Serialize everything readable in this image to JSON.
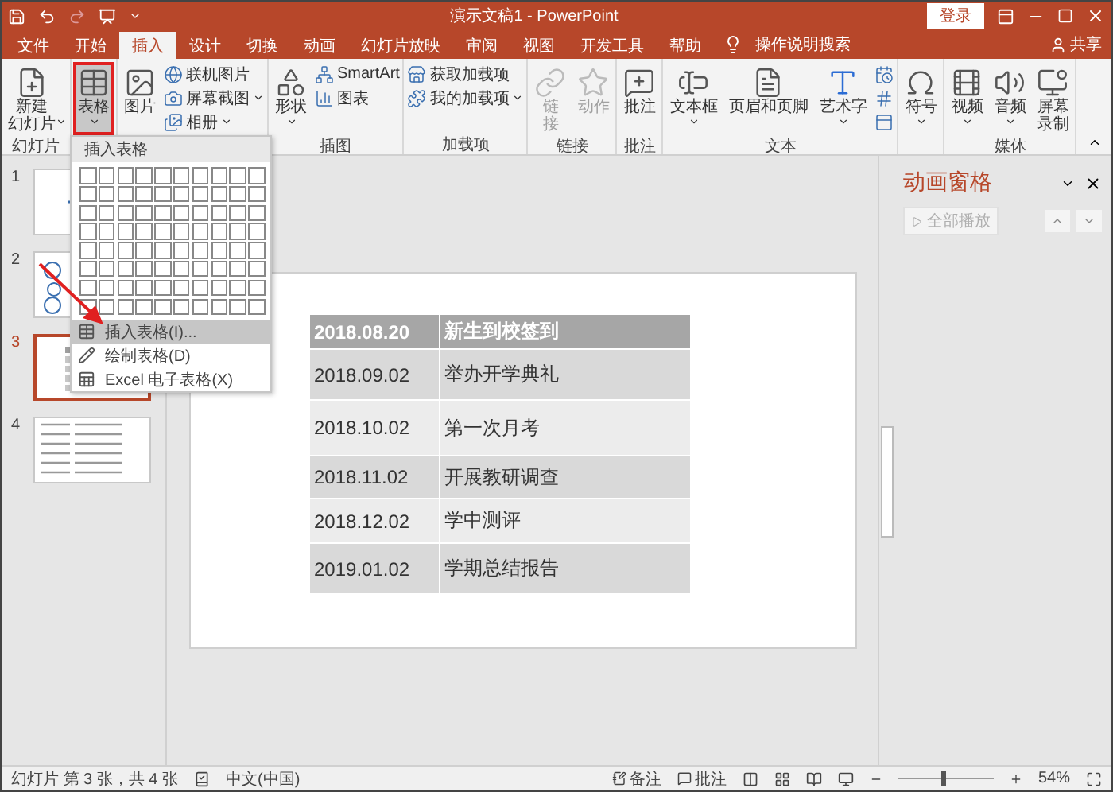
{
  "title_bar": {
    "title": "演示文稿1 - PowerPoint",
    "login": "登录"
  },
  "tabs": [
    {
      "label": "文件",
      "selected": false
    },
    {
      "label": "开始",
      "selected": false
    },
    {
      "label": "插入",
      "selected": true
    },
    {
      "label": "设计",
      "selected": false
    },
    {
      "label": "切换",
      "selected": false
    },
    {
      "label": "动画",
      "selected": false
    },
    {
      "label": "幻灯片放映",
      "selected": false
    },
    {
      "label": "审阅",
      "selected": false
    },
    {
      "label": "视图",
      "selected": false
    },
    {
      "label": "开发工具",
      "selected": false
    },
    {
      "label": "帮助",
      "selected": false
    }
  ],
  "tell_me": "操作说明搜索",
  "share": "共享",
  "ribbon": [
    {
      "label": "幻灯片",
      "items": [
        {
          "kind": "large",
          "lines": [
            "新建",
            "幻灯片"
          ],
          "dropdown": true,
          "disabled": false,
          "pressed": false
        }
      ]
    },
    {
      "items": [
        {
          "kind": "large",
          "lines": [
            "表格"
          ],
          "dropdown": true,
          "disabled": false,
          "pressed": true
        }
      ]
    },
    {
      "items": [
        {
          "kind": "large",
          "lines": [
            "图片"
          ],
          "dropdown": false,
          "disabled": false,
          "pressed": false
        },
        {
          "kind": "small",
          "label": "联机图片",
          "dropdown": false,
          "disabled": false
        },
        {
          "kind": "small",
          "label": "屏幕截图",
          "dropdown": true,
          "disabled": false
        },
        {
          "kind": "small",
          "label": "相册",
          "dropdown": true,
          "disabled": false
        }
      ]
    },
    {
      "label": "插图",
      "items": [
        {
          "kind": "large",
          "lines": [
            "形状"
          ],
          "dropdown": true,
          "disabled": false,
          "pressed": false
        },
        {
          "kind": "small",
          "label": "SmartArt",
          "dropdown": false,
          "disabled": false
        },
        {
          "kind": "small",
          "label": "图表",
          "dropdown": false,
          "disabled": false
        }
      ]
    },
    {
      "label": "加载项",
      "items": [
        {
          "kind": "small",
          "label": "获取加载项",
          "dropdown": false,
          "disabled": false
        },
        {
          "kind": "small",
          "label": "我的加载项",
          "dropdown": true,
          "disabled": false
        }
      ]
    },
    {
      "label": "链接",
      "items": [
        {
          "kind": "large",
          "lines": [
            "链",
            "接"
          ],
          "dropdown": false,
          "disabled": true,
          "pressed": false
        },
        {
          "kind": "large",
          "lines": [
            "动作"
          ],
          "dropdown": false,
          "disabled": true,
          "pressed": false
        }
      ]
    },
    {
      "label": "批注",
      "items": [
        {
          "kind": "large",
          "lines": [
            "批注"
          ],
          "dropdown": false,
          "disabled": false,
          "pressed": false
        }
      ]
    },
    {
      "label": "文本",
      "items": [
        {
          "kind": "large",
          "lines": [
            "文本框"
          ],
          "dropdown": true,
          "disabled": false,
          "pressed": false
        },
        {
          "kind": "large",
          "lines": [
            "页眉和页脚"
          ],
          "dropdown": false,
          "disabled": false,
          "pressed": false
        },
        {
          "kind": "large",
          "lines": [
            "艺术字"
          ],
          "dropdown": true,
          "disabled": false,
          "pressed": false
        },
        {
          "kind": "icon",
          "dropdown": false,
          "disabled": false
        },
        {
          "kind": "icon",
          "dropdown": false,
          "disabled": false
        },
        {
          "kind": "icon",
          "dropdown": false,
          "disabled": false
        }
      ]
    },
    {
      "items": [
        {
          "kind": "large",
          "lines": [
            "符号"
          ],
          "dropdown": true,
          "disabled": false,
          "pressed": false
        }
      ]
    },
    {
      "label": "媒体",
      "items": [
        {
          "kind": "large",
          "lines": [
            "视频"
          ],
          "dropdown": true,
          "disabled": false,
          "pressed": false
        },
        {
          "kind": "large",
          "lines": [
            "音频"
          ],
          "dropdown": true,
          "disabled": false,
          "pressed": false
        },
        {
          "kind": "large",
          "lines": [
            "屏幕",
            "录制"
          ],
          "dropdown": false,
          "disabled": false,
          "pressed": false
        }
      ]
    }
  ],
  "table_menu": {
    "header": "插入表格",
    "items": [
      {
        "label": "插入表格(I)...",
        "selected": true
      },
      {
        "label": "绘制表格(D)",
        "selected": false
      },
      {
        "label": "Excel 电子表格(X)",
        "selected": false
      }
    ]
  },
  "slides": [
    {
      "number": "1",
      "selected": false
    },
    {
      "number": "2",
      "selected": false
    },
    {
      "number": "3",
      "selected": true
    },
    {
      "number": "4",
      "selected": false
    }
  ],
  "slide_table": {
    "rows": [
      {
        "date": "2018.08.20",
        "event": "新生到校签到",
        "header": true
      },
      {
        "date": "2018.09.02",
        "event": "举办开学典礼",
        "header": false
      },
      {
        "date": "2018.10.02",
        "event": "第一次月考",
        "header": false
      },
      {
        "date": "2018.11.02",
        "event": "开展教研调查",
        "header": false
      },
      {
        "date": "2018.12.02",
        "event": "学中测评",
        "header": false
      },
      {
        "date": "2019.01.02",
        "event": "学期总结报告",
        "header": false
      }
    ]
  },
  "animation_pane": {
    "title": "动画窗格",
    "play_all": {
      "label": "全部播放",
      "disabled": true
    }
  },
  "status_bar": {
    "slide_info": "幻灯片 第 3 张，共 4 张",
    "language": "中文(中国)",
    "notes": "备注",
    "comments": "批注",
    "zoom": "54%",
    "zoom_slider": {
      "level": 0.45
    }
  }
}
